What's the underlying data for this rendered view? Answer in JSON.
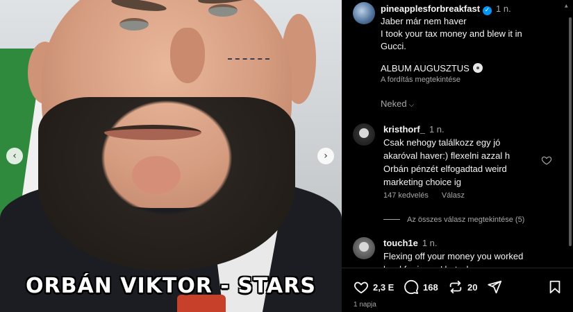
{
  "media": {
    "caption_overlay": "ORBÁN VIKTOR - STARS",
    "prev_icon": "chevron-left-icon",
    "next_icon": "chevron-right-icon"
  },
  "post": {
    "username": "pineapplesforbreakfast",
    "verified": true,
    "time": "1 n.",
    "caption_lines": [
      "Jaber már nem haver",
      "I took your tax money and blew it in",
      "Gucci."
    ],
    "album": "ALBUM AUGUSZTUS",
    "translate": "A fordítás megtekintése",
    "for_you": "Neked"
  },
  "comments": [
    {
      "username": "kristhorf_",
      "time": "1 n.",
      "text_lines": [
        "Csak nehogy találkozz egy jó",
        "akaróval haver:) flexelni azzal h",
        "Orbán pénzét elfogadtad weird",
        "marketing choice ig"
      ],
      "likes": "147 kedvelés",
      "reply": "Válasz",
      "view_replies": "Az összes válasz megtekintése (5)"
    },
    {
      "username": "touch1e",
      "time": "1 n.",
      "text_lines": [
        "Flexing off your money you worked",
        "hard for is coo' but when u say u"
      ]
    }
  ],
  "actions": {
    "likes": "2,3 E",
    "comments": "168",
    "shares": "20",
    "posted_ago": "1 napja"
  },
  "colors": {
    "background": "#000000",
    "text": "#f5f5f5",
    "secondary": "#a8a8a8",
    "verified": "#0095f6"
  }
}
